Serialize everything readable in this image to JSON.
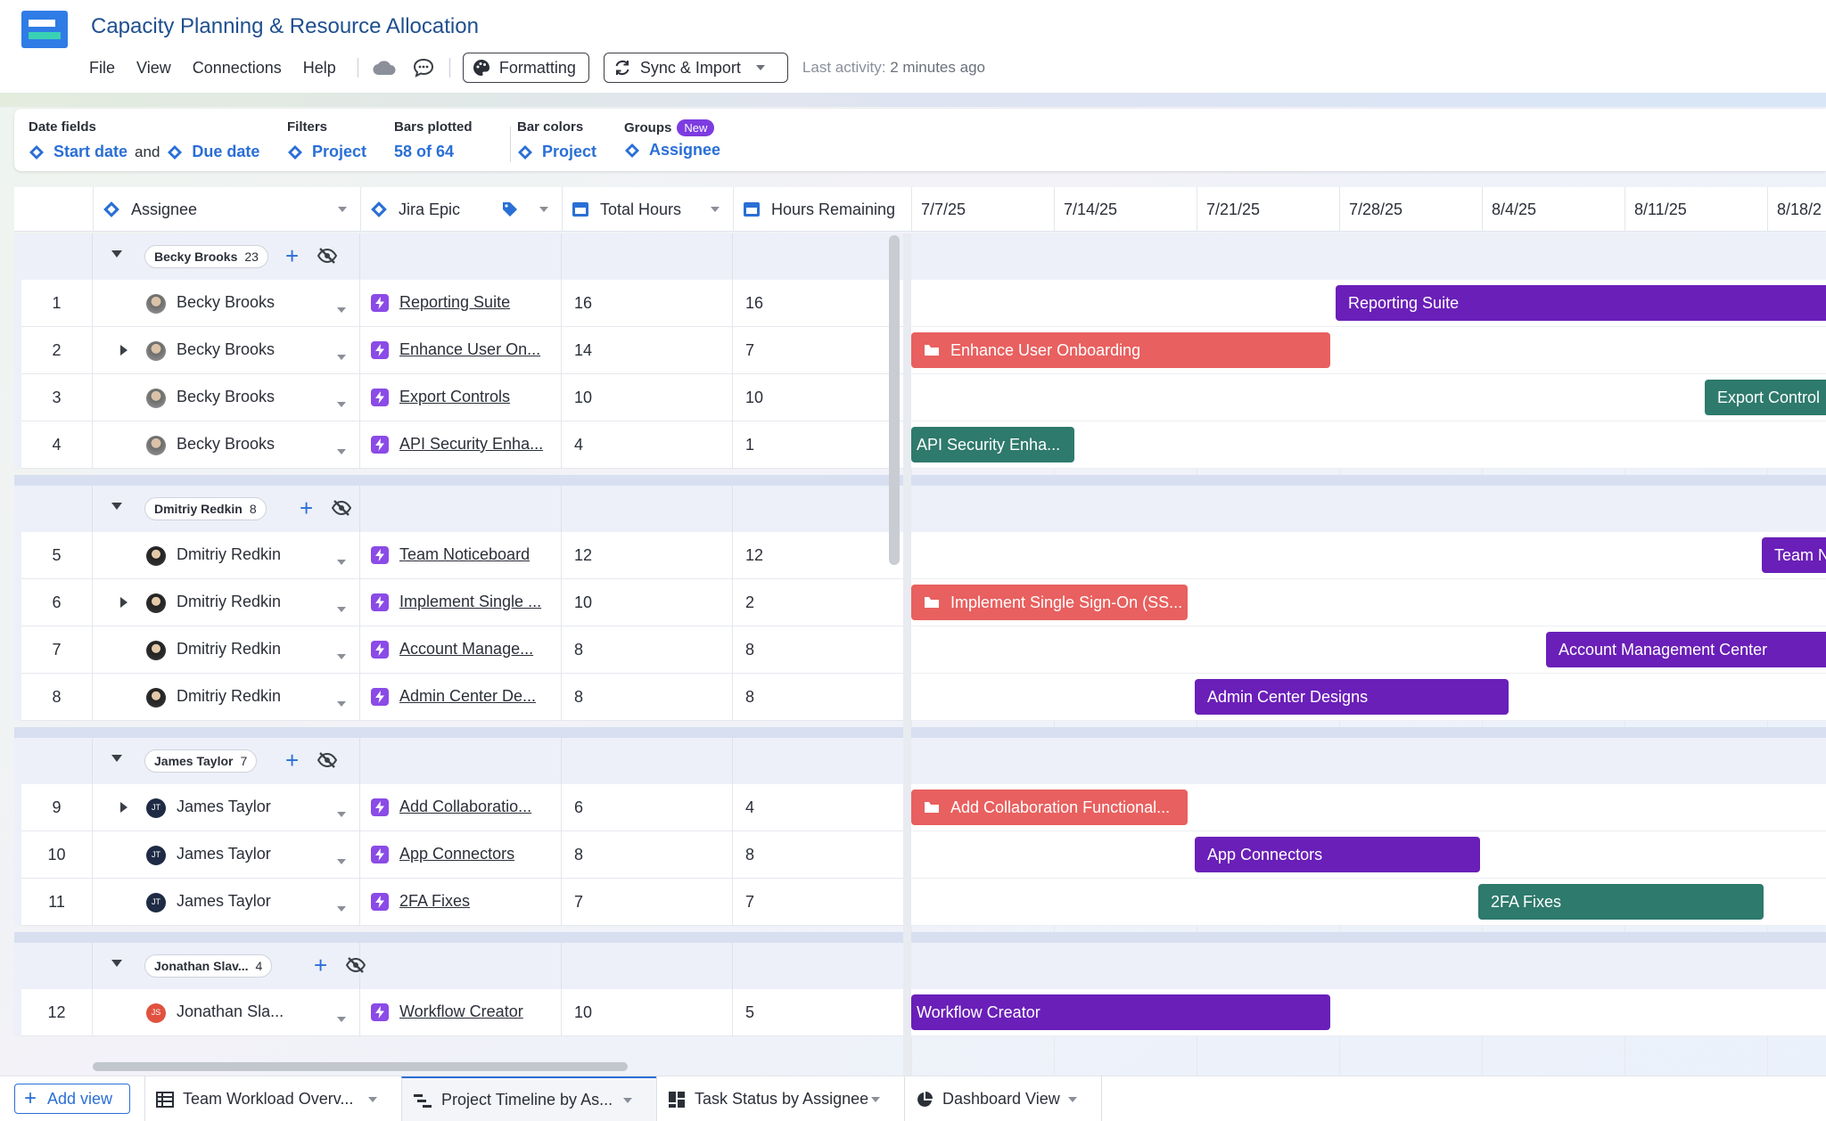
{
  "app": {
    "title": "Capacity Planning & Resource Allocation",
    "menu": [
      "File",
      "View",
      "Connections",
      "Help"
    ],
    "formatting_label": "Formatting",
    "sync_label": "Sync & Import",
    "last_activity_label": "Last activity:",
    "last_activity_value": "2 minutes ago"
  },
  "settings": {
    "date_fields_label": "Date fields",
    "start_date": "Start date",
    "and": "and",
    "due_date": "Due date",
    "filters_label": "Filters",
    "filters_value": "Project",
    "bars_plotted_label": "Bars plotted",
    "bars_plotted_value": "58 of 64",
    "bar_colors_label": "Bar colors",
    "bar_colors_value": "Project",
    "groups_label": "Groups",
    "groups_badge": "New",
    "groups_value": "Assignee"
  },
  "columns": {
    "assignee": "Assignee",
    "epic": "Jira Epic",
    "total": "Total Hours",
    "remaining": "Hours Remaining"
  },
  "timeline_ticks": [
    "7/7/25",
    "7/14/25",
    "7/21/25",
    "7/28/25",
    "8/4/25",
    "8/11/25",
    "8/18/2"
  ],
  "groups": [
    {
      "name": "Becky Brooks",
      "count": "23"
    },
    {
      "name": "Dmitriy Redkin",
      "count": "8"
    },
    {
      "name": "James Taylor",
      "count": "7"
    },
    {
      "name": "Jonathan Slav...",
      "count": "4"
    }
  ],
  "rows": [
    {
      "n": "1",
      "assignee": "Becky Brooks",
      "epic": "Reporting Suite",
      "total": "16",
      "remaining": "16",
      "bar": "Reporting Suite"
    },
    {
      "n": "2",
      "assignee": "Becky Brooks",
      "epic": "Enhance User On...",
      "total": "14",
      "remaining": "7",
      "bar": "Enhance User Onboarding"
    },
    {
      "n": "3",
      "assignee": "Becky Brooks",
      "epic": "Export Controls",
      "total": "10",
      "remaining": "10",
      "bar": "Export Control"
    },
    {
      "n": "4",
      "assignee": "Becky Brooks",
      "epic": "API Security Enha...",
      "total": "4",
      "remaining": "1",
      "bar": "API Security Enha..."
    },
    {
      "n": "5",
      "assignee": "Dmitriy Redkin",
      "epic": "Team Noticeboard",
      "total": "12",
      "remaining": "12",
      "bar": "Team N"
    },
    {
      "n": "6",
      "assignee": "Dmitriy Redkin",
      "epic": "Implement Single ...",
      "total": "10",
      "remaining": "2",
      "bar": "Implement Single Sign-On (SS..."
    },
    {
      "n": "7",
      "assignee": "Dmitriy Redkin",
      "epic": "Account Manage...",
      "total": "8",
      "remaining": "8",
      "bar": "Account Management Center"
    },
    {
      "n": "8",
      "assignee": "Dmitriy Redkin",
      "epic": "Admin Center De...",
      "total": "8",
      "remaining": "8",
      "bar": "Admin Center Designs"
    },
    {
      "n": "9",
      "assignee": "James Taylor",
      "epic": "Add Collaboratio...",
      "total": "6",
      "remaining": "4",
      "bar": "Add Collaboration Functional..."
    },
    {
      "n": "10",
      "assignee": "James Taylor",
      "epic": "App Connectors",
      "total": "8",
      "remaining": "8",
      "bar": "App Connectors"
    },
    {
      "n": "11",
      "assignee": "James Taylor",
      "epic": "2FA Fixes",
      "total": "7",
      "remaining": "7",
      "bar": "2FA Fixes"
    },
    {
      "n": "12",
      "assignee": "Jonathan Sla...",
      "epic": "Workflow Creator",
      "total": "10",
      "remaining": "5",
      "bar": "Workflow Creator"
    }
  ],
  "colors": {
    "purple": "#6a1fb8",
    "red": "#e8605f",
    "teal": "#2e7a6c",
    "accent": "#2a6fd6"
  },
  "tabs": {
    "add_view": "Add view",
    "items": [
      "Team Workload Overv...",
      "Project Timeline by As...",
      "Task Status by Assignee",
      "Dashboard View"
    ]
  }
}
